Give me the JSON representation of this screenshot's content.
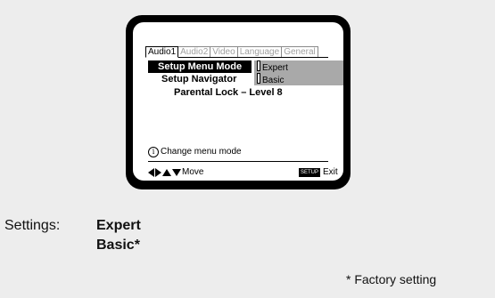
{
  "tabs": [
    "Audio1",
    "Audio2",
    "Video",
    "Language",
    "General"
  ],
  "menu": {
    "row1_label": "Setup Menu Mode",
    "row1_value": "Expert",
    "row2_label": "Setup Navigator",
    "row2_value": "Basic",
    "row3_label": "Parental Lock – Level 8"
  },
  "info_text": "Change menu mode",
  "info_icon": "i",
  "nav_text": "Move",
  "setup_badge": "SETUP",
  "exit_text": "Exit",
  "settings": {
    "label": "Settings:",
    "option1": "Expert",
    "option2": "Basic*"
  },
  "footnote": "* Factory setting"
}
